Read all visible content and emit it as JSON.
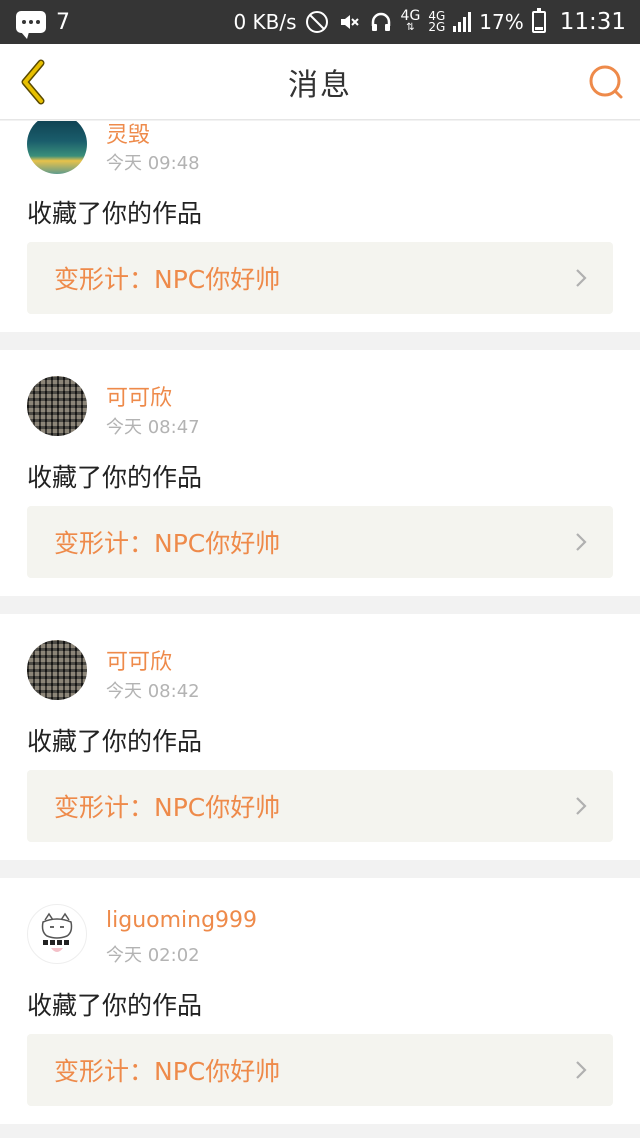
{
  "status_bar": {
    "notification_count": "7",
    "speed": "0 KB/s",
    "net_primary": "4G",
    "net_sub_top": "4G",
    "net_sub_bottom": "2G",
    "battery": "17%",
    "time": "11:31"
  },
  "header": {
    "title": "消息",
    "accent_color": "#ee8a4a",
    "back_color": "#e0b800"
  },
  "messages": [
    {
      "user": "灵毁",
      "time": "今天 09:48",
      "action": "收藏了你的作品",
      "work": "变形计：NPC你好帅",
      "avatar": "landscape-avatar"
    },
    {
      "user": "可可欣",
      "time": "今天 08:47",
      "action": "收藏了你的作品",
      "work": "变形计：NPC你好帅",
      "avatar": "pattern-avatar"
    },
    {
      "user": "可可欣",
      "time": "今天 08:42",
      "action": "收藏了你的作品",
      "work": "变形计：NPC你好帅",
      "avatar": "pattern-avatar"
    },
    {
      "user": "liguoming999",
      "time": "今天 02:02",
      "action": "收藏了你的作品",
      "work": "变形计：NPC你好帅",
      "avatar": "cat-avatar"
    }
  ]
}
